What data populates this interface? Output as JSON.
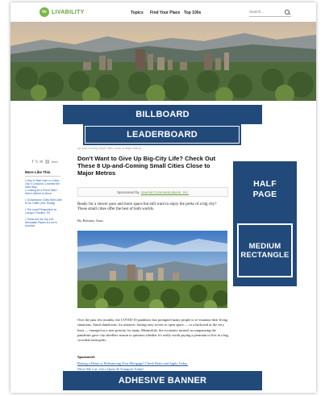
{
  "header": {
    "logo_text": "LIVABILITY",
    "logo_mark": "liv",
    "nav": [
      "Topics",
      "Find Your Place",
      "Top 100s"
    ],
    "search_placeholder": "Search..."
  },
  "ads": {
    "billboard": "BILLBOARD",
    "leaderboard": "LEADERBOARD",
    "half_page_line1": "HALF",
    "half_page_line2": "PAGE",
    "medium_rect_line1": "MEDIUM",
    "medium_rect_line2": "RECTANGLE",
    "adhesive": "ADHESIVE BANNER"
  },
  "article": {
    "breadcrumb": "Up-and-Coming Small Cities Close to Major Metros",
    "title": "Don't Want to Give Up Big-City Life? Check Out These 8 Up-and-Coming Small Cities Close to Major Metros",
    "sponsored_prefix": "Sponsored by",
    "sponsor": "Journal Communications, Inc.",
    "intro": "Ready for a slower pace and more space but still want to enjoy the perks of a big city? These small cities offer the best of both worlds.",
    "byline": "By Brittany Anas",
    "body": "Over the past few months, the COVID-19 pandemic has prompted many people to re-examine their living situations. Amid shutdowns, for instance, having easy access to open space — or a backyard at the very least — emerged as a new priority for many. Meanwhile, the economic turmoil accompanying the pandemic gave city-dwellers reason to question whether it's really worth paying a premium to live in a big, crowded metropolis.",
    "sponsored_label": "Sponsored:",
    "sponsored_links": [
      "Buying a Home or Refinancing Your Mortgage? Check Rates and Apply Today.",
      "Move My Car: Get a Quote & Transport Today!"
    ]
  },
  "rail": {
    "share_more": "More",
    "more_like_this": "More Like This",
    "items": [
      "How to Start Over in a New City: 6 Lessons I Learned the Hard Way",
      "Looking for a Fresh Start? Here's Where to Move",
      "10 Awesome Cities With Little to No Traffic (Yes, Really)",
      "The Local Perspective on Living in Franklin, TN",
      "These Are the Top 100 Affordable Places to Live in America"
    ]
  },
  "colors": {
    "ad_blue": "#21497a",
    "brand_green": "#7ab648",
    "link_blue": "#1f5ca8"
  }
}
